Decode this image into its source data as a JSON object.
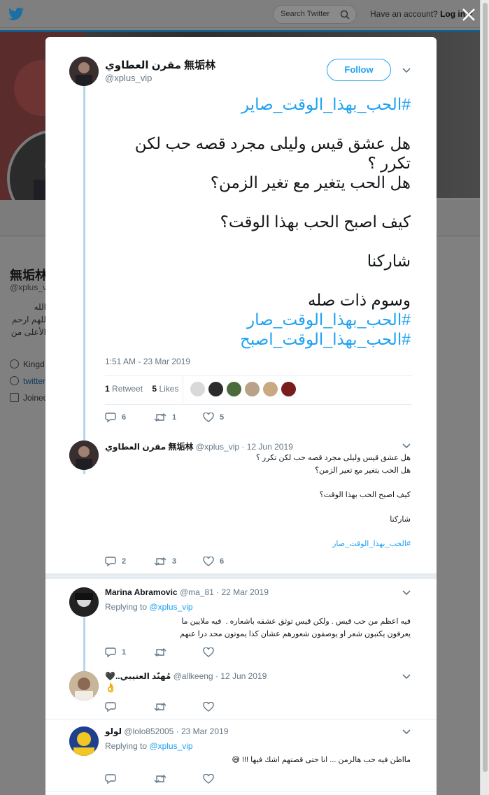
{
  "topbar": {
    "search_placeholder": "Search Twitter",
    "account_prompt": "Have an account?",
    "login_label": "Log in"
  },
  "profile_bg": {
    "name": "無垢林",
    "handle": "@xplus_v",
    "bio_lines": [
      "الله",
      "للهم ارحم",
      "الأعلى من"
    ],
    "location": "Kingd",
    "link": "twitter",
    "joined": "Joined"
  },
  "tweet": {
    "author_name": "مقرن العطاوي 無垢林",
    "author_handle": "@xplus_vip",
    "follow_label": "Follow",
    "hashtag_top": "#الحب_بهذا_الوقت_صاير",
    "body": "هل عشق قيس وليلى مجرد قصه حب لكن تكرر ؟\nهل الحب يتغير مع تغير الزمن؟\n\nكيف اصبح الحب بهذا الوقت؟\n\nشاركنا\n\nوسوم ذات صله",
    "hashtag_1": "#الحب_بهذا_الوقت_صار",
    "hashtag_2": "#الحب_بهذا_الوقت_اصبح",
    "timestamp": "1:51 AM - 23 Mar 2019",
    "retweet_count": "1",
    "retweet_label": "Retweet",
    "like_count": "5",
    "like_label": "Likes",
    "actions": {
      "replies": "6",
      "retweets": "1",
      "likes": "5"
    }
  },
  "replies": [
    {
      "name": "مقرن العطاوي 無垢林",
      "handle": "@xplus_vip",
      "date": "· 12 Jun 2019",
      "text": "هل عشق قيس وليلى مجرد قصه حب لكن تكرر ؟\nهل الحب يتغير مع تغير الزمن؟\n\nكيف اصبح الحب بهذا الوقت؟\n\nشاركنا\n",
      "hashtag": "#الحب_بهذا_الوقت_صار",
      "actions": {
        "replies": "2",
        "retweets": "3",
        "likes": "6"
      }
    },
    {
      "name": "Marina Abramovic",
      "handle": "@ma_81",
      "date": "· 22 Mar 2019",
      "replying_label": "Replying to",
      "replying_to": "@xplus_vip",
      "text": "فيه اعظم من حب قيس . ولكن قيس توثق عشقه باشعاره .  فيه ملايين ما يعرفون يكتبون شعر او يوصفون شعورهم عشان كذا يموتون محد درا عنهم",
      "actions": {
        "replies": "1",
        "retweets": "",
        "likes": ""
      }
    },
    {
      "name": "🖤..مُهنّد العتيبي",
      "handle": "@allkeeng",
      "date": "· 12 Jun 2019",
      "text": "👌",
      "actions": {
        "replies": "",
        "retweets": "",
        "likes": ""
      }
    },
    {
      "name": "لولو",
      "handle": "@lolo852005",
      "date": "· 23 Mar 2019",
      "replying_label": "Replying to",
      "replying_to": "@xplus_vip",
      "text": "مااظن فيه حب هالزمن ... انا حتى قصتهم اشك فيها !!! 😅",
      "actions": {
        "replies": "",
        "retweets": "",
        "likes": ""
      }
    }
  ],
  "colors": {
    "accent": "#1da1f2",
    "thread_line": "#b5d6ee",
    "muted": "#657786",
    "overlay": "#808080"
  }
}
